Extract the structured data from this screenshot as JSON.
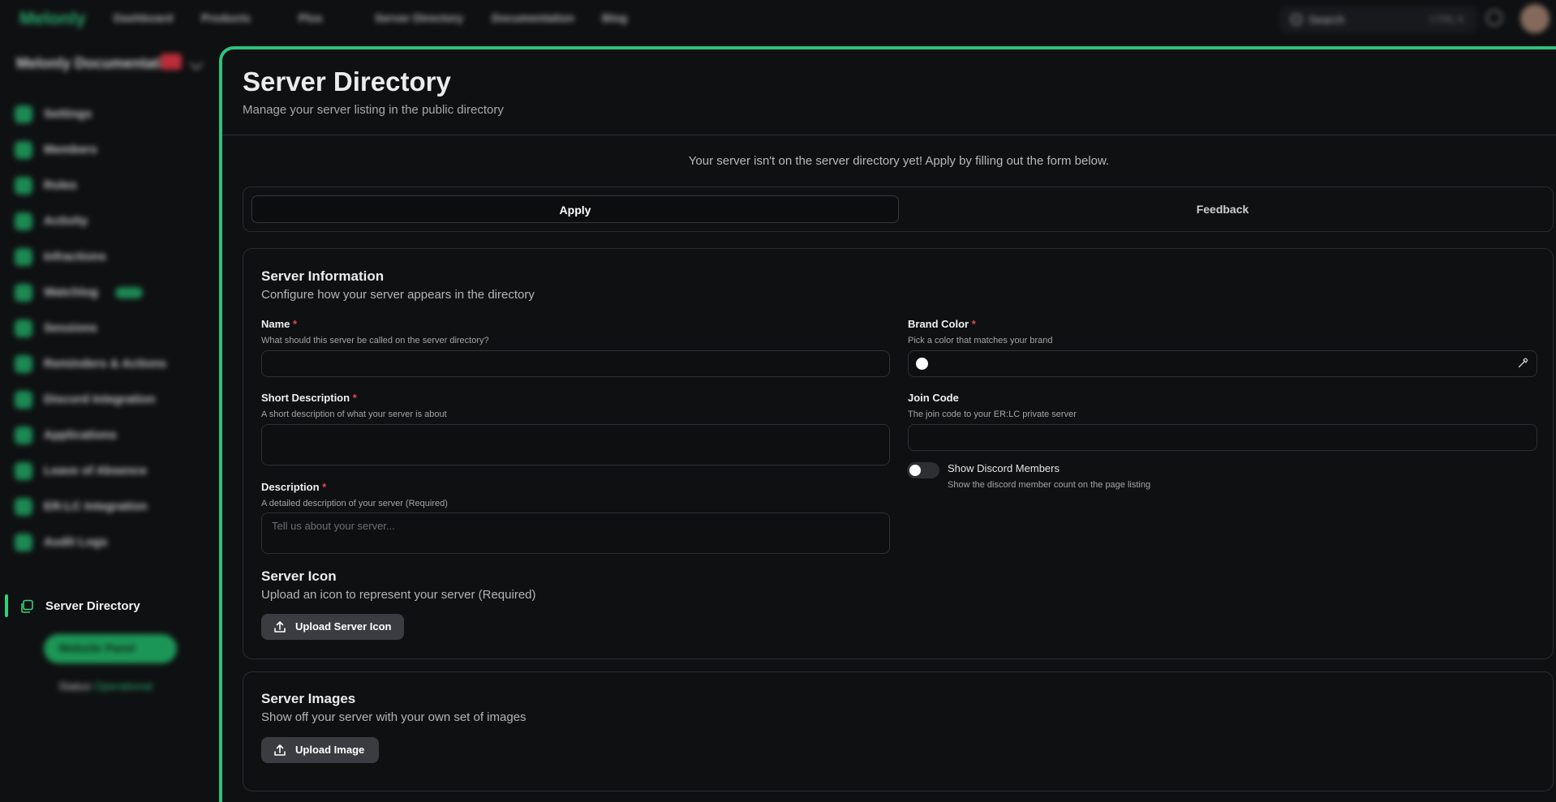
{
  "topbar": {
    "logo": "Melonly",
    "nav": [
      "Dashboard",
      "Products",
      "Plus",
      "Server Directory",
      "Documentation",
      "Blog"
    ],
    "search_label": "Search",
    "search_shortcut": "CTRL K"
  },
  "sidebar": {
    "guild_name": "Melonly Documentati...",
    "items": [
      {
        "label": "Settings"
      },
      {
        "label": "Members"
      },
      {
        "label": "Roles"
      },
      {
        "label": "Activity"
      },
      {
        "label": "Infractions"
      },
      {
        "label": "Watchlog",
        "badge": "NEW"
      },
      {
        "label": "Sessions"
      },
      {
        "label": "Reminders & Actions"
      },
      {
        "label": "Discord Integration"
      },
      {
        "label": "Applications"
      },
      {
        "label": "Leave of Absence"
      },
      {
        "label": "ER:LC Integration"
      },
      {
        "label": "Audit Logs"
      }
    ],
    "active_item": "Server Directory",
    "website_button": "Website Panel",
    "status_label": "Status",
    "status_value": "Operational"
  },
  "main": {
    "title": "Server Directory",
    "subtitle": "Manage your server listing in the public directory",
    "notice": "Your server isn't on the server directory yet! Apply by filling out the form below.",
    "tabs": [
      {
        "label": "Apply",
        "active": true
      },
      {
        "label": "Feedback",
        "active": false
      }
    ]
  },
  "server_info": {
    "title": "Server Information",
    "subtitle": "Configure how your server appears in the directory",
    "name": {
      "label": "Name",
      "required": "*",
      "help": "What should this server be called on the server directory?",
      "value": ""
    },
    "short_desc": {
      "label": "Short Description",
      "required": "*",
      "help": "A short description of what your server is about",
      "value": ""
    },
    "description": {
      "label": "Description",
      "required": "*",
      "help": "A detailed description of your server (Required)",
      "placeholder": "Tell us about your server..."
    },
    "brand_color": {
      "label": "Brand Color",
      "required": "*",
      "help": "Pick a color that matches your brand",
      "value": "#ffffff"
    },
    "join_code": {
      "label": "Join Code",
      "help": "The join code to your ER:LC private server",
      "value": ""
    },
    "show_members": {
      "label": "Show Discord Members",
      "help": "Show the discord member count on the page listing",
      "enabled": false
    },
    "icon_title": "Server Icon",
    "icon_subtitle": "Upload an icon to represent your server (Required)",
    "icon_button": "Upload Server Icon"
  },
  "server_images": {
    "title": "Server Images",
    "subtitle": "Show off your server with your own set of images",
    "button": "Upload Image"
  },
  "colors": {
    "accent": "#2ec27e",
    "required": "#e5484d",
    "background": "#0f1012"
  }
}
